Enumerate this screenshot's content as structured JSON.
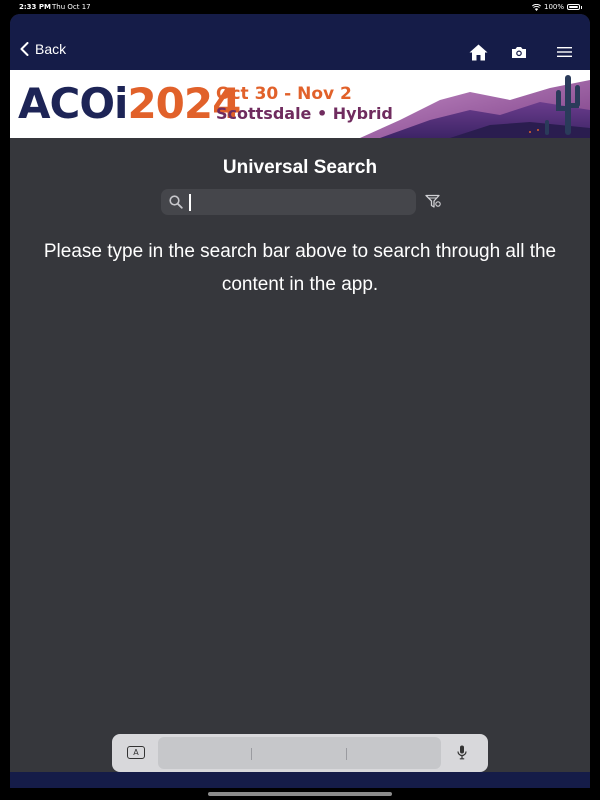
{
  "status_bar": {
    "time": "2:33 PM",
    "date": "Thu Oct 17",
    "battery": "100%"
  },
  "navbar": {
    "back_label": "Back",
    "icons": [
      "home-icon",
      "camera-icon",
      "menu-icon"
    ]
  },
  "banner": {
    "logo_acoi": "ACOi",
    "logo_year": "2024",
    "dates": "Oct 30 - Nov 2",
    "location": "Scottsdale • Hybrid"
  },
  "search": {
    "title": "Universal Search",
    "value": "",
    "placeholder": "",
    "hint": "Please type in the search bar above to search through all the content in the app."
  },
  "keyboard_bar": {
    "left_key": "A",
    "icons": [
      "keyboard-a-icon",
      "microphone-icon"
    ]
  },
  "colors": {
    "navbar": "#151c48",
    "background": "#36373c",
    "brand_orange": "#e1612a",
    "brand_navy": "#1d2456",
    "brand_purple": "#702c5f"
  }
}
